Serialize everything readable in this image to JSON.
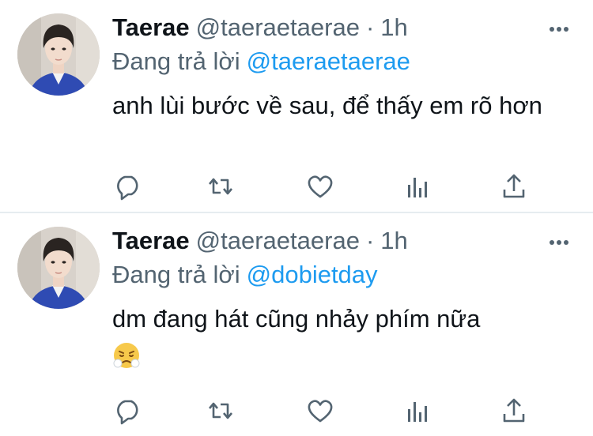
{
  "colors": {
    "name": "#0f1419",
    "secondary": "#536471",
    "link": "#1d9bf0",
    "icon": "#536471",
    "divider": "#e6ecf0"
  },
  "icons": {
    "more": "more-dots-icon",
    "reply": "reply-bubble-icon",
    "retweet": "retweet-icon",
    "like": "heart-icon",
    "stats": "bar-chart-icon",
    "share": "share-upload-icon"
  },
  "tweets": [
    {
      "name": "Taerae",
      "handle": "@taeraetaerae",
      "separator": "·",
      "time": "1h",
      "replying_label": "Đang trả lời",
      "replying_to": "@taeraetaerae",
      "text": "anh lùi bước về sau, để thấy em rõ hơn",
      "emoji": ""
    },
    {
      "name": "Taerae",
      "handle": "@taeraetaerae",
      "separator": "·",
      "time": "1h",
      "replying_label": "Đang trả lời",
      "replying_to": "@dobietday",
      "text": "dm đang hát cũng nhảy phím nữa",
      "emoji": "😤"
    }
  ]
}
